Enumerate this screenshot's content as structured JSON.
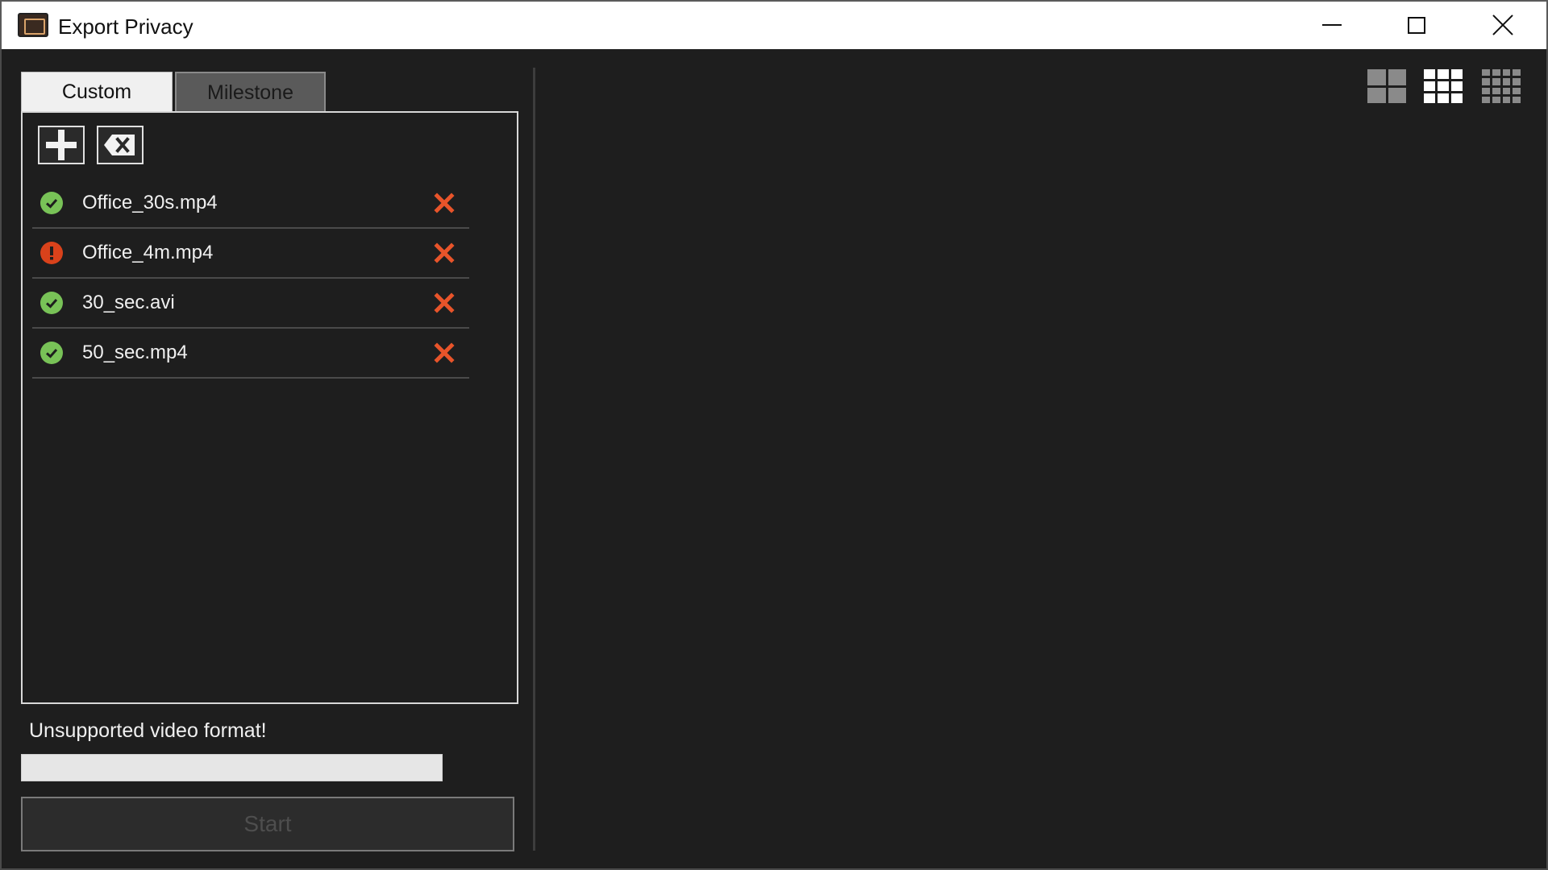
{
  "window": {
    "title": "Export Privacy",
    "app_icon": "app-icon",
    "controls": [
      "minimize-icon",
      "maximize-icon",
      "close-icon"
    ]
  },
  "tabs": [
    {
      "label": "Custom",
      "active": true
    },
    {
      "label": "Milestone",
      "active": false
    }
  ],
  "toolbar": {
    "add_icon": "plus-icon",
    "clear_icon": "backspace-icon"
  },
  "files": [
    {
      "name": "Office_30s.mp4",
      "status": "ok",
      "status_icon": "check-circle-icon",
      "remove_icon": "close-x-icon"
    },
    {
      "name": "Office_4m.mp4",
      "status": "error",
      "status_icon": "exclamation-circle-icon",
      "remove_icon": "close-x-icon"
    },
    {
      "name": "30_sec.avi",
      "status": "ok",
      "status_icon": "check-circle-icon",
      "remove_icon": "close-x-icon"
    },
    {
      "name": "50_sec.mp4",
      "status": "ok",
      "status_icon": "check-circle-icon",
      "remove_icon": "close-x-icon"
    }
  ],
  "status_message": "Unsupported video format!",
  "progress": 0,
  "start_label": "Start",
  "layout_options": [
    {
      "icon": "grid-2x2-icon",
      "selected": false
    },
    {
      "icon": "grid-3x3-icon",
      "selected": true
    },
    {
      "icon": "grid-4x4-icon",
      "selected": false
    }
  ],
  "colors": {
    "background": "#1e1e1e",
    "ok": "#78c257",
    "error": "#d9421b",
    "remove": "#e8542a"
  }
}
